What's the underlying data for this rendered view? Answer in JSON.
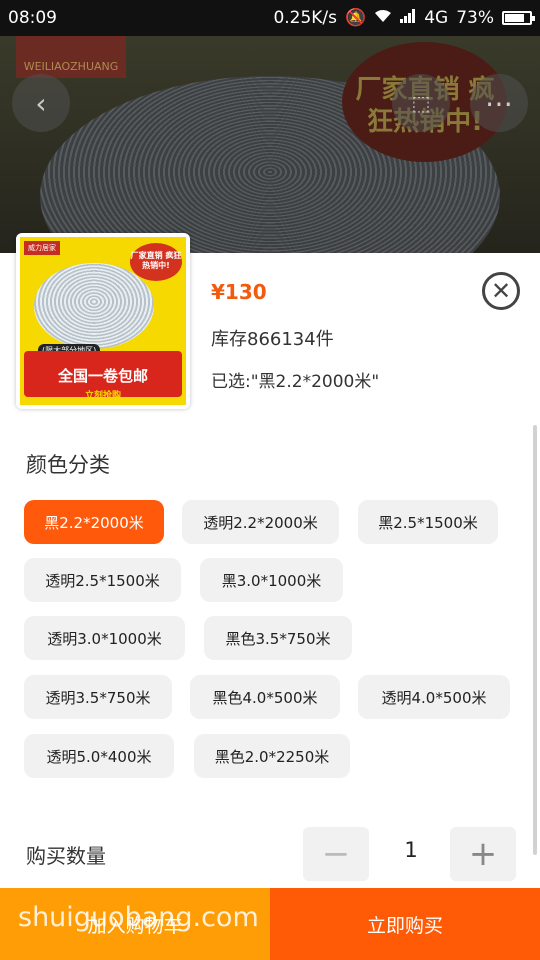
{
  "status_bar": {
    "time": "08:09",
    "network_speed": "0.25K/s",
    "network_type": "4G",
    "battery": "73%",
    "battery_level": 0.73
  },
  "background": {
    "logo_text": "WEILIAOZHUANG",
    "badge_text": "厂家直销 疯狂热销中!"
  },
  "thumbnail": {
    "logo": "威力居家",
    "badge": "厂家直销 疯狂热销中!",
    "tag": "(限大部分地区)",
    "banner": "全国一卷包邮",
    "sub": "立刻抢购"
  },
  "product": {
    "price": "¥130",
    "stock": "库存866134件",
    "selected": "已选:\"黑2.2*2000米\""
  },
  "options": {
    "title": "颜色分类",
    "items": [
      {
        "label": "黑2.2*2000米",
        "active": true
      },
      {
        "label": "透明2.2*2000米",
        "active": false
      },
      {
        "label": "黑2.5*1500米",
        "active": false
      },
      {
        "label": "透明2.5*1500米",
        "active": false
      },
      {
        "label": "黑3.0*1000米",
        "active": false
      },
      {
        "label": "透明3.0*1000米",
        "active": false
      },
      {
        "label": "黑色3.5*750米",
        "active": false
      },
      {
        "label": "透明3.5*750米",
        "active": false
      },
      {
        "label": "黑色4.0*500米",
        "active": false
      },
      {
        "label": "透明4.0*500米",
        "active": false
      },
      {
        "label": "透明5.0*400米",
        "active": false
      },
      {
        "label": "黑色2.0*2250米",
        "active": false
      }
    ]
  },
  "quantity": {
    "label": "购买数量",
    "minus": "−",
    "value": "1",
    "plus": "+"
  },
  "actions": {
    "add_to_cart": "加入购物车",
    "buy_now": "立即购买"
  },
  "watermark": "shuiguobang.com",
  "colors": {
    "accent": "#ff5a0b",
    "cart": "#ff9d06",
    "price": "#f25a0e"
  }
}
